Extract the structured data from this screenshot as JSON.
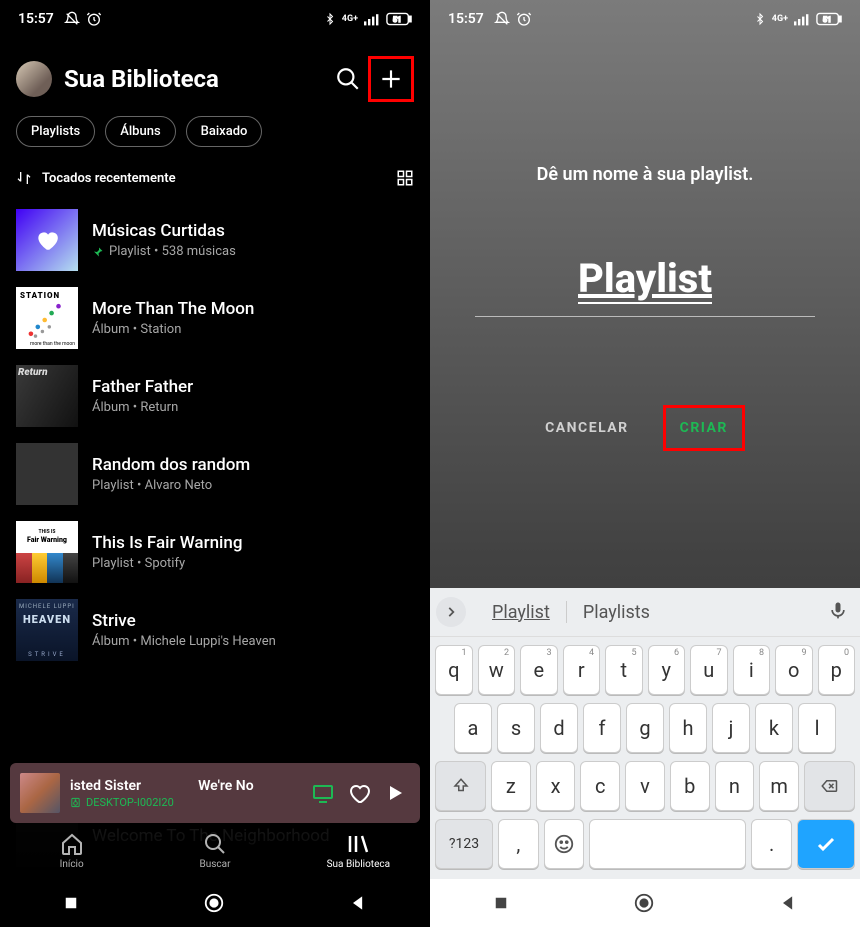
{
  "status": {
    "time": "15:57"
  },
  "header": {
    "title": "Sua Biblioteca"
  },
  "chips": {
    "playlists": "Playlists",
    "albums": "Álbuns",
    "downloaded": "Baixado"
  },
  "sort": {
    "label": "Tocados recentemente"
  },
  "items": [
    {
      "title": "Músicas Curtidas",
      "sub": "Playlist • 538 músicas",
      "pinned": true,
      "liked": true
    },
    {
      "title": "More Than The Moon",
      "sub": "Álbum • Station"
    },
    {
      "title": "Father Father",
      "sub": "Álbum • Return"
    },
    {
      "title": "Random dos random",
      "sub": "Playlist • Alvaro Neto"
    },
    {
      "title": "This Is Fair Warning",
      "sub": "Playlist • Spotify"
    },
    {
      "title": "Strive",
      "sub": "Álbum • Michele Luppi's Heaven"
    }
  ],
  "ghost": {
    "title": "Welcome To The Neighborhood"
  },
  "now_playing": {
    "line1_left": "isted Sister",
    "line1_right": "We're No",
    "device": "DESKTOP-I002I20"
  },
  "tabs": {
    "home": "Início",
    "search": "Buscar",
    "library": "Sua Biblioteca"
  },
  "dialog": {
    "prompt": "Dê um nome à sua playlist.",
    "name": "Playlist",
    "cancel": "CANCELAR",
    "create": "CRIAR"
  },
  "keyboard": {
    "suggestions": [
      "Playlist",
      "Playlists"
    ],
    "row1": [
      [
        "q",
        "1"
      ],
      [
        "w",
        "2"
      ],
      [
        "e",
        "3"
      ],
      [
        "r",
        "4"
      ],
      [
        "t",
        "5"
      ],
      [
        "y",
        "6"
      ],
      [
        "u",
        "7"
      ],
      [
        "i",
        "8"
      ],
      [
        "o",
        "9"
      ],
      [
        "p",
        "0"
      ]
    ],
    "row2": [
      "a",
      "s",
      "d",
      "f",
      "g",
      "h",
      "j",
      "k",
      "l"
    ],
    "row3": [
      "z",
      "x",
      "c",
      "v",
      "b",
      "n",
      "m"
    ],
    "sym": "?123",
    "comma": ",",
    "dot": "."
  }
}
